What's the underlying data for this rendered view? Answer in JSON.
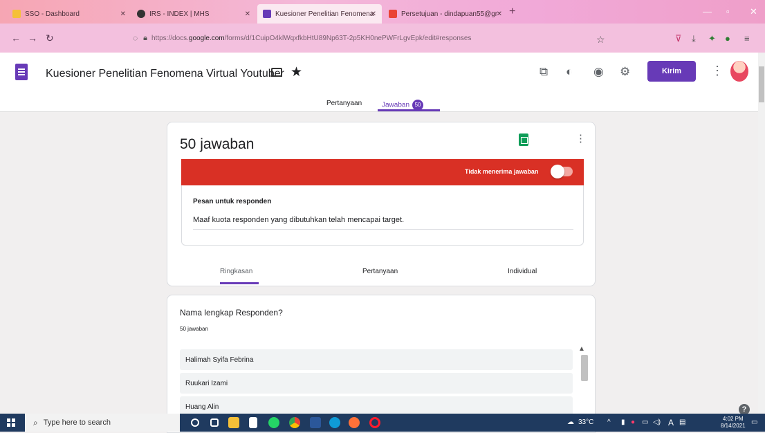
{
  "browser": {
    "tabs": [
      {
        "label": "SSO - Dashboard",
        "color": "#f5c038"
      },
      {
        "label": "IRS - INDEX | MHS",
        "color": "#333333"
      },
      {
        "label": "Kuesioner Penelitian Fenomena",
        "color": "#673ab7"
      },
      {
        "label": "Persetujuan - dindapuan55@gr",
        "color": "#ea4335"
      }
    ],
    "url_prefix": "https://docs.",
    "url_host": "google.com",
    "url_rest": "/forms/d/1CuipO4klWqxfkbHtU89Np63T-2p5KH0nePWFrLgvEpk/edit#responses"
  },
  "forms": {
    "title": "Kuesioner Penelitian Fenomena Virtual Youtuber",
    "send_label": "Kirim",
    "tabs": {
      "questions": "Pertanyaan",
      "responses": "Jawaban",
      "response_count": "50"
    }
  },
  "responses_card": {
    "title": "50 jawaban",
    "accepting_label": "Tidak menerima jawaban",
    "message_label": "Pesan untuk responden",
    "message_text": "Maaf kuota responden yang dibutuhkan telah mencapai target.",
    "subtabs": {
      "summary": "Ringkasan",
      "question": "Pertanyaan",
      "individual": "Individual"
    }
  },
  "question_card": {
    "title": "Nama lengkap Responden?",
    "count": "50 jawaban",
    "answers": [
      "Halimah Syifa Febrina",
      "Ruukari Izami",
      "Huang Alin"
    ]
  },
  "taskbar": {
    "search_placeholder": "Type here to search",
    "weather": "33°C",
    "time": "4:02 PM",
    "date": "8/14/2021",
    "lang": "A"
  },
  "colors": {
    "accent": "#673ab7",
    "banner": "#d93025",
    "sheets": "#0f9d58"
  }
}
